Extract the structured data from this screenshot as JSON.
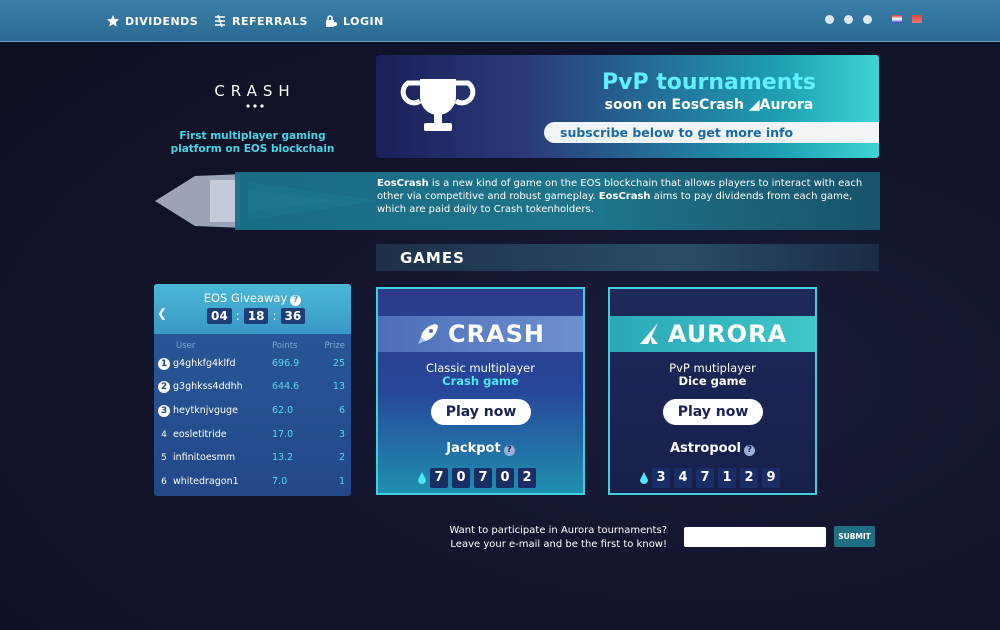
{
  "nav": {
    "dividends": "DIVIDENDS",
    "referrals": "REFERRALS",
    "login": "LOGIN"
  },
  "logo": {
    "text": "CRASH",
    "tagline_line1": "First multiplayer gaming",
    "tagline_line2": "platform on EOS blockchain"
  },
  "banner": {
    "title": "PvP tournaments",
    "subtitle": "soon on EosCrash ◢Aurora",
    "cta": "subscribe below to get more info"
  },
  "description": {
    "brand1": "EosCrash",
    "text1": " is a new kind of game on the EOS blockchain that allows players to interact with each other via competitive and robust gameplay. ",
    "brand2": "EosCrash",
    "text2": " aims to pay dividends from each game, which are paid daily to Crash tokenholders."
  },
  "games_heading": "GAMES",
  "giveaway": {
    "title": "EOS Giveaway",
    "timer": [
      "04",
      "18",
      "36"
    ],
    "columns": {
      "user": "User",
      "points": "Points",
      "prize": "Prize"
    },
    "rows": [
      {
        "rank": "1",
        "user": "g4ghkfg4klfd",
        "points": "696.9",
        "prize": "25"
      },
      {
        "rank": "2",
        "user": "g3ghkss4ddhh",
        "points": "644.6",
        "prize": "13"
      },
      {
        "rank": "3",
        "user": "heytknjvguge",
        "points": "62.0",
        "prize": "6"
      },
      {
        "rank": "4",
        "user": "eosletitride",
        "points": "17.0",
        "prize": "3"
      },
      {
        "rank": "5",
        "user": "infinitoesmm",
        "points": "13.2",
        "prize": "2"
      },
      {
        "rank": "6",
        "user": "whitedragon1",
        "points": "7.0",
        "prize": "1"
      }
    ]
  },
  "games": {
    "crash": {
      "name": "CRASH",
      "line1": "Classic multiplayer",
      "line2": "Crash game",
      "button": "Play now",
      "pot_label": "Jackpot",
      "digits": [
        "7",
        "0",
        "7",
        "0",
        "2"
      ]
    },
    "aurora": {
      "name": "AURORA",
      "line1": "PvP mutiplayer",
      "line2": "Dice game",
      "button": "Play now",
      "pot_label": "Astropool",
      "digits": [
        "3",
        "4",
        "7",
        "1",
        "2",
        "9"
      ]
    }
  },
  "subscribe": {
    "line1": "Want to participate in Aurora tournaments?",
    "line2": "Leave your e-mail and be the first to know!",
    "input_value": "",
    "button": "SUBMIT"
  },
  "colors": {
    "accent": "#47d6e8",
    "topbar": "#3a7fa8",
    "background": "#12142c"
  }
}
